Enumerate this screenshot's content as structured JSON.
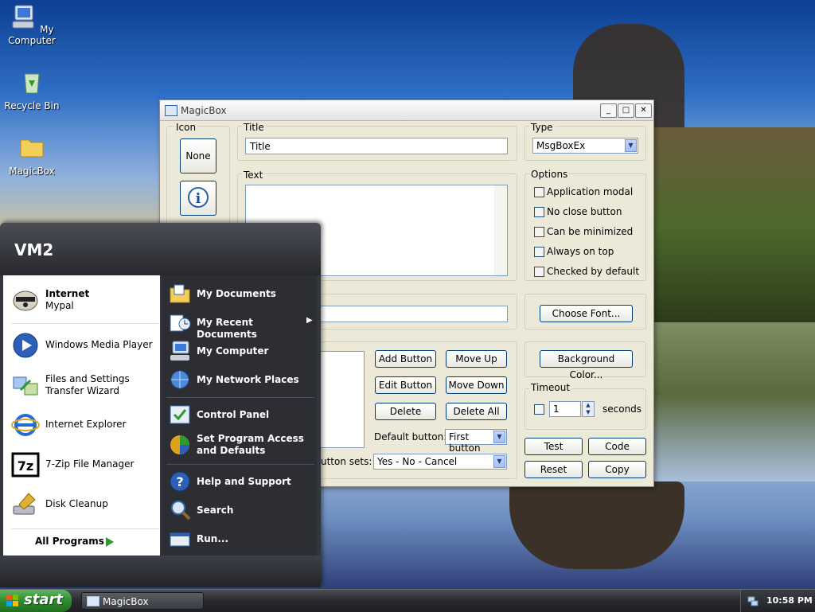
{
  "desktop": {
    "icons": [
      {
        "label": "My Computer",
        "icon": "my-computer-icon"
      },
      {
        "label": "Recycle Bin",
        "icon": "recycle-bin-icon"
      },
      {
        "label": "MagicBox",
        "icon": "folder-icon"
      }
    ]
  },
  "window": {
    "title": "MagicBox",
    "icon_group": {
      "label": "Icon",
      "none_button": "None"
    },
    "title_group": {
      "label": "Title",
      "value": "Title"
    },
    "text_group": {
      "label": "Text",
      "value": ""
    },
    "type_group": {
      "label": "Type",
      "selected": "MsgBoxEx"
    },
    "options_group": {
      "label": "Options",
      "items": [
        {
          "label": "Application modal",
          "checked": false
        },
        {
          "label": "No close button",
          "checked": false
        },
        {
          "label": "Can be minimized",
          "checked": false
        },
        {
          "label": "Always on top",
          "checked": false
        },
        {
          "label": "Checked by default",
          "checked": false
        }
      ]
    },
    "font_group": {
      "choose_font": "Choose Font..."
    },
    "buttons_group": {
      "add_button": "Add Button",
      "move_up": "Move Up",
      "edit_button": "Edit Button",
      "move_down": "Move Down",
      "delete": "Delete",
      "delete_all": "Delete All",
      "default_button_label": "Default button:",
      "default_button_value": "First button",
      "button_sets_label": "utton sets:",
      "button_sets_value": "Yes - No - Cancel"
    },
    "background_color": "Background Color...",
    "timeout": {
      "label": "Timeout",
      "value": "1",
      "unit": "seconds"
    },
    "actions": {
      "test": "Test",
      "code": "Code",
      "reset": "Reset",
      "copy": "Copy"
    }
  },
  "start_menu": {
    "user_name": "VM2",
    "pinned": [
      {
        "title": "Internet",
        "subtitle": "Mypal",
        "icon": "mypal-browser-icon"
      }
    ],
    "recent": [
      {
        "label": "Windows Media Player",
        "icon": "media-player-icon"
      },
      {
        "label": "Files and Settings Transfer Wizard",
        "icon": "transfer-wizard-icon"
      },
      {
        "label": "Internet Explorer",
        "icon": "internet-explorer-icon"
      },
      {
        "label": "7-Zip File Manager",
        "icon": "7zip-icon"
      },
      {
        "label": "Disk Cleanup",
        "icon": "disk-cleanup-icon"
      }
    ],
    "all_programs": "All Programs",
    "right": {
      "my_documents": "My Documents",
      "my_recent_documents": "My Recent Documents",
      "my_computer": "My Computer",
      "my_network_places": "My Network Places",
      "control_panel": "Control Panel",
      "set_program_access": "Set Program Access and Defaults",
      "help_support": "Help and Support",
      "search": "Search",
      "run": "Run..."
    }
  },
  "taskbar": {
    "start_label": "start",
    "task_magicbox": "MagicBox",
    "clock": "10:58 PM"
  }
}
